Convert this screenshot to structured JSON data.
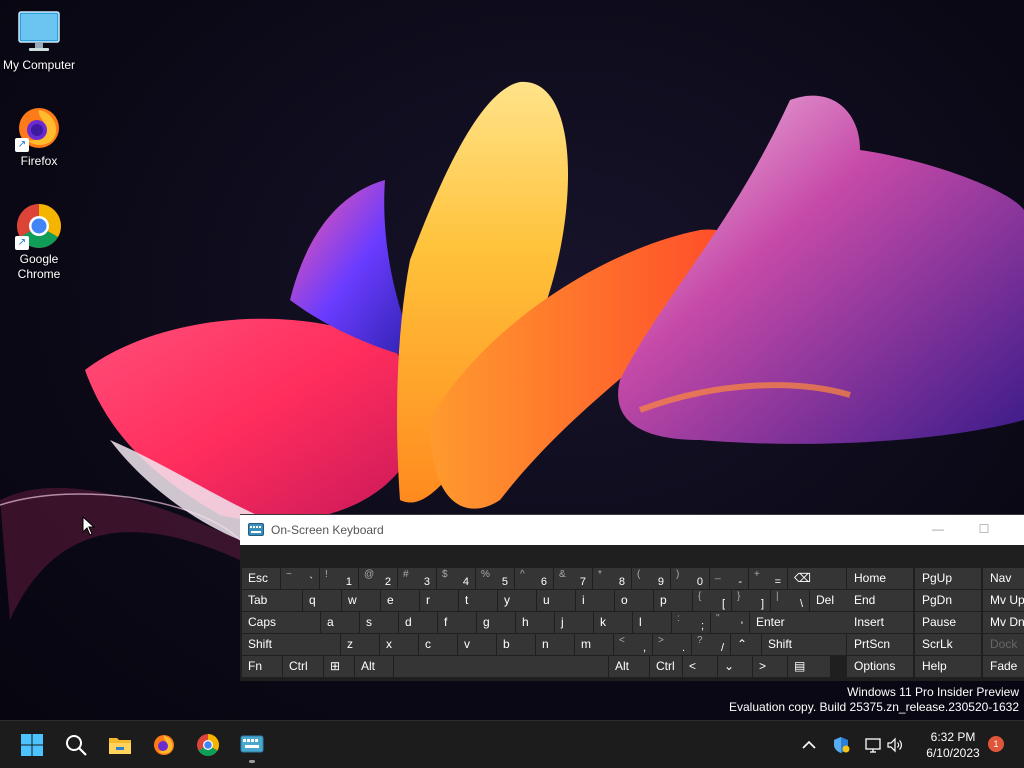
{
  "desktop": {
    "icons": [
      {
        "label": "My Computer",
        "icon": "monitor-icon"
      },
      {
        "label": "Firefox",
        "icon": "firefox-icon"
      },
      {
        "label": "Google Chrome",
        "icon": "chrome-icon"
      }
    ],
    "watermark_line1": "Windows 11 Pro Insider Preview",
    "watermark_line2": "Evaluation copy. Build 25375.zn_release.230520-1632"
  },
  "osk": {
    "title": "On-Screen Keyboard",
    "minimize_glyph": "—",
    "maximize_glyph": "☐",
    "rows": [
      [
        {
          "main": "Esc"
        },
        {
          "hi": "~",
          "lo": "`"
        },
        {
          "hi": "!",
          "lo": "1"
        },
        {
          "hi": "@",
          "lo": "2"
        },
        {
          "hi": "#",
          "lo": "3"
        },
        {
          "hi": "$",
          "lo": "4"
        },
        {
          "hi": "%",
          "lo": "5"
        },
        {
          "hi": "^",
          "lo": "6"
        },
        {
          "hi": "&",
          "lo": "7"
        },
        {
          "hi": "*",
          "lo": "8"
        },
        {
          "hi": "(",
          "lo": "9"
        },
        {
          "hi": ")",
          "lo": "0"
        },
        {
          "hi": "_",
          "lo": "-"
        },
        {
          "hi": "+",
          "lo": "="
        },
        {
          "main": "⌫"
        }
      ],
      [
        {
          "main": "Tab"
        },
        {
          "main": "q"
        },
        {
          "main": "w"
        },
        {
          "main": "e"
        },
        {
          "main": "r"
        },
        {
          "main": "t"
        },
        {
          "main": "y"
        },
        {
          "main": "u"
        },
        {
          "main": "i"
        },
        {
          "main": "o"
        },
        {
          "main": "p"
        },
        {
          "hi": "{",
          "lo": "["
        },
        {
          "hi": "}",
          "lo": "]"
        },
        {
          "hi": "|",
          "lo": "\\"
        },
        {
          "main": "Del"
        }
      ],
      [
        {
          "main": "Caps"
        },
        {
          "main": "a"
        },
        {
          "main": "s"
        },
        {
          "main": "d"
        },
        {
          "main": "f"
        },
        {
          "main": "g"
        },
        {
          "main": "h"
        },
        {
          "main": "j"
        },
        {
          "main": "k"
        },
        {
          "main": "l"
        },
        {
          "hi": ":",
          "lo": ";"
        },
        {
          "hi": "\"",
          "lo": "'"
        },
        {
          "main": "Enter"
        }
      ],
      [
        {
          "main": "Shift"
        },
        {
          "main": "z"
        },
        {
          "main": "x"
        },
        {
          "main": "c"
        },
        {
          "main": "v"
        },
        {
          "main": "b"
        },
        {
          "main": "n"
        },
        {
          "main": "m"
        },
        {
          "hi": "<",
          "lo": ","
        },
        {
          "hi": ">",
          "lo": "."
        },
        {
          "hi": "?",
          "lo": "/"
        },
        {
          "main": "⌃"
        },
        {
          "main": "Shift"
        }
      ],
      [
        {
          "main": "Fn"
        },
        {
          "main": "Ctrl"
        },
        {
          "main": "⊞"
        },
        {
          "main": "Alt"
        },
        {
          "main": ""
        },
        {
          "main": "Alt"
        },
        {
          "main": "Ctrl"
        },
        {
          "main": "<"
        },
        {
          "main": "⌄"
        },
        {
          "main": ">"
        },
        {
          "main": "▤"
        }
      ]
    ],
    "nav_keys": [
      [
        "Home",
        "PgUp",
        "Nav"
      ],
      [
        "End",
        "PgDn",
        "Mv Up"
      ],
      [
        "Insert",
        "Pause",
        "Mv Dn"
      ],
      [
        "PrtScn",
        "ScrLk",
        "Dock"
      ],
      [
        "Options",
        "Help",
        "Fade"
      ]
    ]
  },
  "taskbar": {
    "apps": [
      {
        "name": "start",
        "icon": "windows-logo-icon"
      },
      {
        "name": "search",
        "icon": "search-icon"
      },
      {
        "name": "file-explorer",
        "icon": "folder-icon"
      },
      {
        "name": "firefox",
        "icon": "firefox-icon"
      },
      {
        "name": "chrome",
        "icon": "chrome-icon"
      },
      {
        "name": "on-screen-keyboard",
        "icon": "keyboard-icon"
      }
    ],
    "tray": {
      "overflow_glyph": "^",
      "time": "6:32 PM",
      "date": "6/10/2023",
      "notification_count": "1"
    }
  },
  "colors": {
    "osk_key": "#353535",
    "osk_body": "#1f1f1f",
    "taskbar": "#1c1c1c",
    "accent": "#0078d4"
  }
}
